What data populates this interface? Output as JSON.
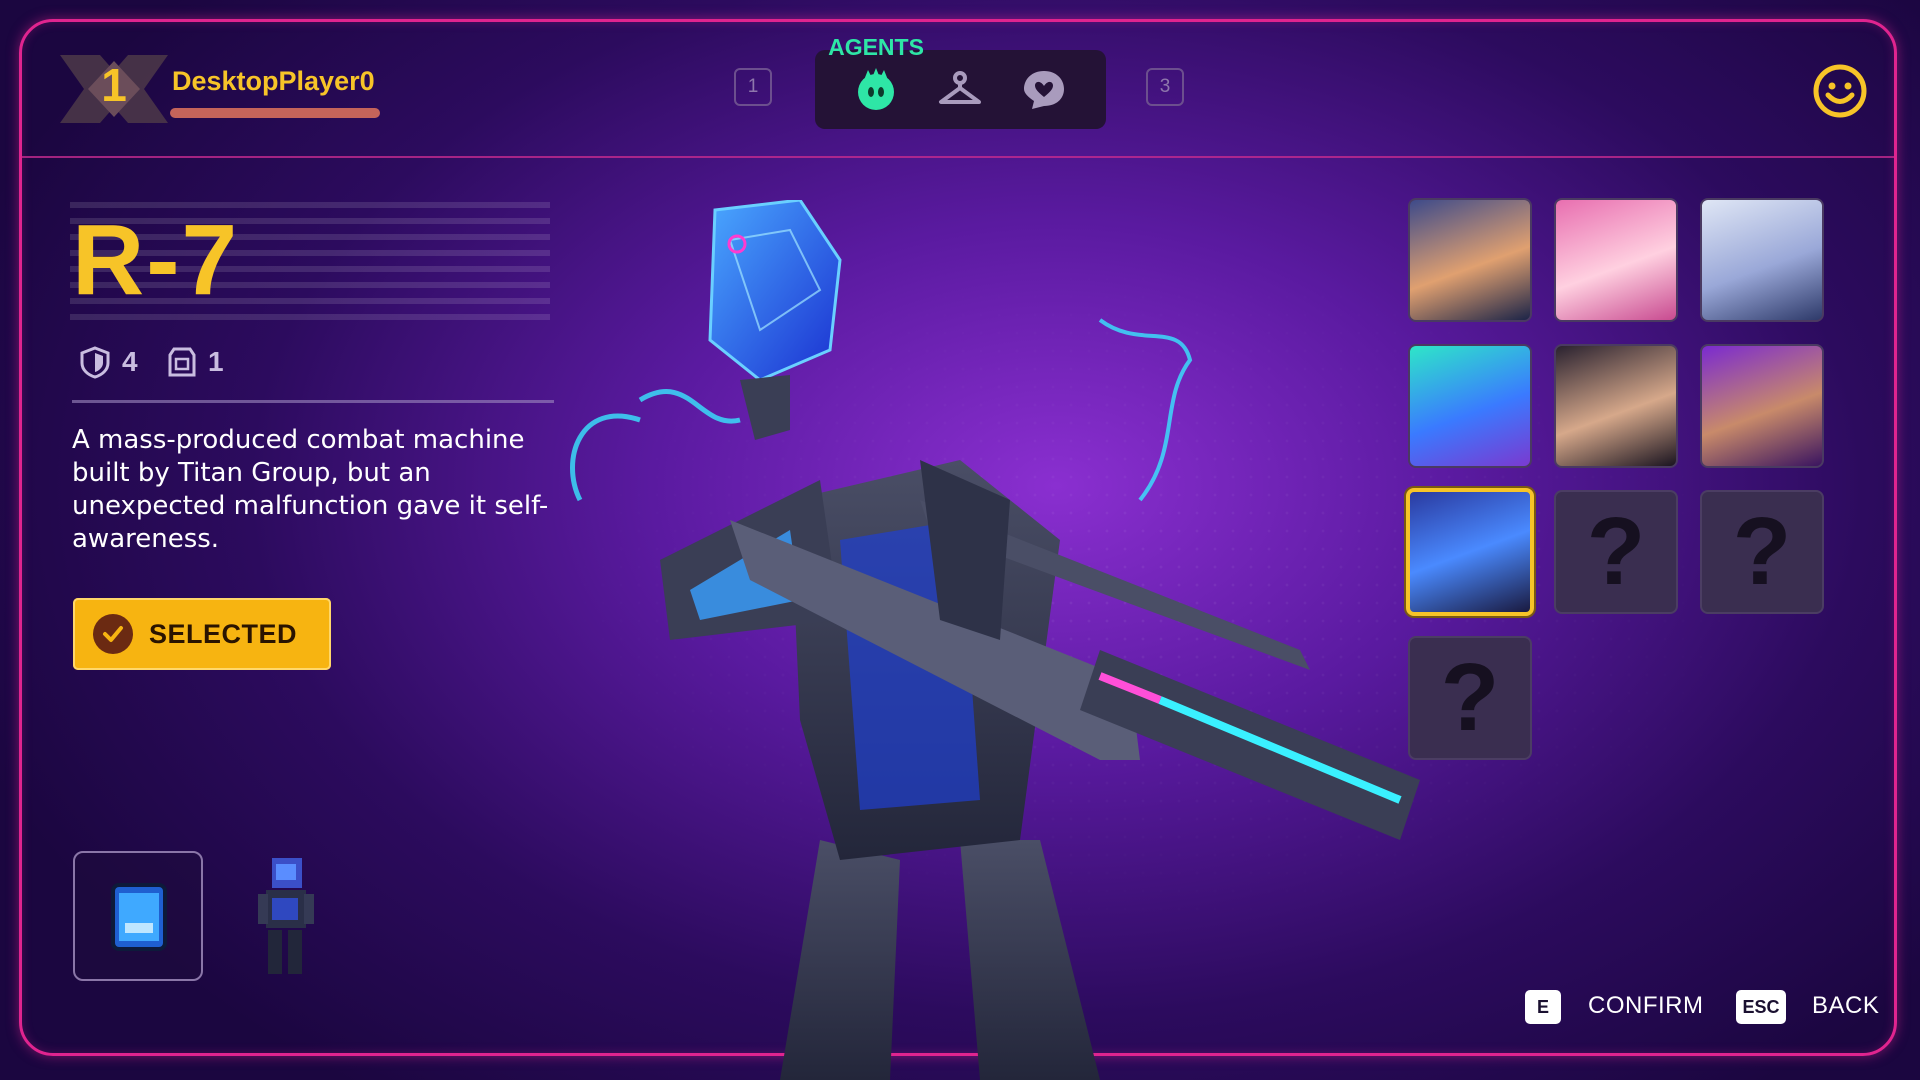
{
  "player": {
    "level": "1",
    "name": "DesktopPlayer0"
  },
  "tabs": {
    "title": "AGENTS",
    "left_key": "1",
    "right_key": "3",
    "items": [
      {
        "icon": "agent-icon",
        "active": true
      },
      {
        "icon": "hanger-icon",
        "active": false
      },
      {
        "icon": "emote-icon",
        "active": false
      }
    ]
  },
  "agent": {
    "name": "R-7",
    "stats": [
      {
        "icon": "shield-icon",
        "value": "4"
      },
      {
        "icon": "armor-icon",
        "value": "1"
      }
    ],
    "description": "A mass-produced combat machine built by Titan Group, but an unexpected malfunction gave it self-awareness.",
    "status_label": "SELECTED"
  },
  "roster": [
    {
      "name": "agent-portrait-1",
      "locked": false,
      "selected": false
    },
    {
      "name": "agent-portrait-2",
      "locked": false,
      "selected": false
    },
    {
      "name": "agent-portrait-3",
      "locked": false,
      "selected": false
    },
    {
      "name": "agent-portrait-4",
      "locked": false,
      "selected": false
    },
    {
      "name": "agent-portrait-5",
      "locked": false,
      "selected": false
    },
    {
      "name": "agent-portrait-6",
      "locked": false,
      "selected": false
    },
    {
      "name": "agent-portrait-r7",
      "locked": false,
      "selected": true
    },
    {
      "name": "locked-agent-1",
      "locked": true,
      "label": "?"
    },
    {
      "name": "locked-agent-2",
      "locked": true,
      "label": "?"
    },
    {
      "name": "locked-agent-3",
      "locked": true,
      "label": "?"
    }
  ],
  "footer": {
    "confirm_key": "E",
    "confirm_label": "CONFIRM",
    "back_key": "ESC",
    "back_label": "BACK"
  },
  "colors": {
    "accent_gold": "#f7c428",
    "accent_green": "#2ee6a6",
    "frame_pink": "#e0248f"
  }
}
